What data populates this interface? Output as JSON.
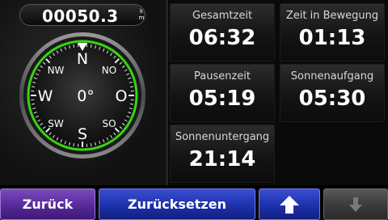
{
  "odometer": {
    "value": "00050.3",
    "unit_top": "k",
    "unit_bottom": "m"
  },
  "compass": {
    "heading": "0°",
    "cardinals": {
      "north": "N",
      "east": "O",
      "south": "S",
      "west": "W"
    },
    "intercardinals": {
      "northwest": "NW",
      "northeast": "NO",
      "southwest": "SW",
      "southeast": "SO"
    },
    "ring_color": "#39d411"
  },
  "tiles": [
    {
      "label": "Gesamtzeit",
      "value": "06:32"
    },
    {
      "label": "Zeit in Bewegung",
      "value": "01:13"
    },
    {
      "label": "Pausenzeit",
      "value": "05:19"
    },
    {
      "label": "Sonnenaufgang",
      "value": "05:30"
    },
    {
      "label": "Sonnenuntergang",
      "value": "21:14"
    }
  ],
  "buttons": {
    "back": "Zurück",
    "reset": "Zurücksetzen",
    "up_icon": "arrow-up-icon",
    "down_icon": "arrow-down-icon"
  },
  "colors": {
    "back_button": "#5a2c9c",
    "reset_button": "#1f33b0",
    "down_button_disabled": "#3c3c3c"
  }
}
